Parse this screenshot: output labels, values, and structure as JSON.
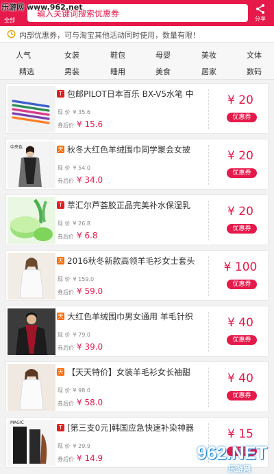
{
  "watermark": {
    "top_left": "乐游网 www.962.net",
    "bottom_big": "962.NET",
    "bottom_small": "乐游网"
  },
  "header": {
    "left_label": "全部",
    "search_text": "输入关键词搜索优惠券",
    "share_label": "分享",
    "bg_color": "#e6194b"
  },
  "notice": {
    "icon": "clock-icon",
    "text": "内部优惠券，可与淘宝其他活动同时使用，数量有限！"
  },
  "categories": {
    "row1": [
      "人气",
      "女装",
      "鞋包",
      "母婴",
      "美妆",
      "文体"
    ],
    "row2": [
      "精选",
      "男装",
      "睡用",
      "美食",
      "居家",
      "数码"
    ]
  },
  "products": [
    {
      "platform": "T",
      "title": "包邮PILOT日本百乐 BX-V5水笔 中",
      "orig_label": "现 价",
      "orig_price": "¥ 35.6",
      "cur_label": "券后价",
      "cur_price": "¥ 15.6",
      "coupon": "¥ 20",
      "coupon_btn": "优惠券"
    },
    {
      "platform": "天猫",
      "title": "秋冬大红色羊绒围巾同学聚会女披",
      "orig_label": "现 价",
      "orig_price": "¥ 54.0",
      "cur_label": "券后价",
      "cur_price": "¥ 34.0",
      "coupon": "¥ 20",
      "coupon_btn": "优惠券"
    },
    {
      "platform": "T",
      "title": "萃汇尔芦荟胶正品完美补水保湿乳",
      "orig_label": "现 价",
      "orig_price": "¥ 26.8",
      "cur_label": "券后价",
      "cur_price": "¥ 6.8",
      "coupon": "¥ 20",
      "coupon_btn": "优惠券"
    },
    {
      "platform": "天猫",
      "title": "2016秋冬新款高领羊毛衫女士套头",
      "orig_label": "现 价",
      "orig_price": "¥ 159.0",
      "cur_label": "券后价",
      "cur_price": "¥ 59.0",
      "coupon": "¥ 100",
      "coupon_btn": "优惠券"
    },
    {
      "platform": "天猫",
      "title": "大红色羊绒围巾男女通用 羊毛针织",
      "orig_label": "现 价",
      "orig_price": "¥ 79.0",
      "cur_label": "券后价",
      "cur_price": "¥ 39.0",
      "coupon": "¥ 40",
      "coupon_btn": "优惠券"
    },
    {
      "platform": "天猫",
      "title": "【天天特价】女装羊毛衫女长袖甜",
      "orig_label": "现 价",
      "orig_price": "¥ 98.0",
      "cur_label": "券后价",
      "cur_price": "¥ 58.0",
      "coupon": "¥ 40",
      "coupon_btn": "优惠券"
    },
    {
      "platform": "T",
      "title": "[第三支0元]韩国应急快速补染神器",
      "orig_label": "现 价",
      "orig_price": "¥ 29.9",
      "cur_label": "券后价",
      "cur_price": "¥ 14.9",
      "coupon": "¥ 15",
      "coupon_btn": "优惠券"
    }
  ],
  "thumb_labels": {
    "p2": "中央色",
    "p7_brand": "MAGIC"
  }
}
